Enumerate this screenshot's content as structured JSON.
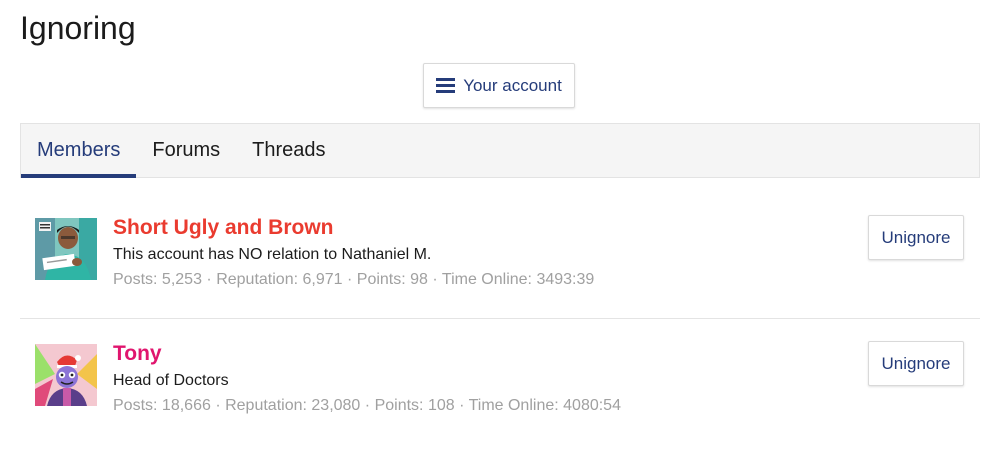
{
  "page": {
    "title": "Ignoring"
  },
  "account_button": {
    "label": "Your account",
    "icon": "hamburger-menu-icon"
  },
  "tabs": [
    {
      "label": "Members",
      "active": true
    },
    {
      "label": "Forums",
      "active": false
    },
    {
      "label": "Threads",
      "active": false
    }
  ],
  "members": [
    {
      "name": "Short Ugly and Brown",
      "name_color": "#ea3b2f",
      "tagline": "This account has NO relation to Nathaniel M.",
      "stats": {
        "posts_label": "Posts:",
        "posts": "5,253",
        "reputation_label": "Reputation:",
        "reputation": "6,971",
        "points_label": "Points:",
        "points": "98",
        "time_label": "Time Online:",
        "time_online": "3493:39"
      },
      "button": "Unignore"
    },
    {
      "name": "Tony",
      "name_color": "#e0156e",
      "tagline": "Head of Doctors",
      "stats": {
        "posts_label": "Posts:",
        "posts": "18,666",
        "reputation_label": "Reputation:",
        "reputation": "23,080",
        "points_label": "Points:",
        "points": "108",
        "time_label": "Time Online:",
        "time_online": "4080:54"
      },
      "button": "Unignore"
    }
  ],
  "stats_separator": "·",
  "colors": {
    "accent": "#253c7a",
    "muted": "#a0a0a0"
  }
}
